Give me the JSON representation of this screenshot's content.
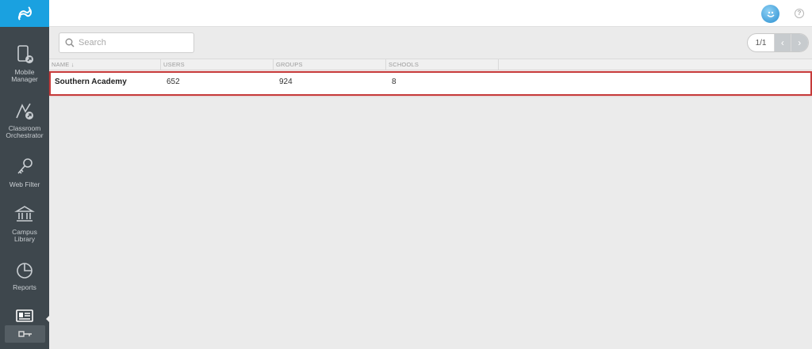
{
  "sidebar": {
    "items": [
      {
        "label_line1": "Mobile",
        "label_line2": "Manager",
        "icon": "mobile-manager-icon"
      },
      {
        "label_line1": "Classroom",
        "label_line2": "Orchestrator",
        "icon": "classroom-orchestrator-icon"
      },
      {
        "label_line1": "Web Filter",
        "label_line2": "",
        "icon": "key-icon"
      },
      {
        "label_line1": "Campus",
        "label_line2": "Library",
        "icon": "library-icon"
      },
      {
        "label_line1": "Reports",
        "label_line2": "",
        "icon": "pie-chart-icon"
      }
    ],
    "active_icon": "id-card-icon",
    "sub_icon": "key-small-icon"
  },
  "search": {
    "placeholder": "Search"
  },
  "pagination": {
    "label": "1/1",
    "prev": "‹",
    "next": "›"
  },
  "table": {
    "columns": [
      "NAME ↓",
      "USERS",
      "GROUPS",
      "SCHOOLS"
    ],
    "rows": [
      {
        "name": "Southern Academy",
        "users": "652",
        "groups": "924",
        "schools": "8"
      }
    ]
  },
  "colors": {
    "sidebar": "#3e474d",
    "brand": "#1aa1e0",
    "highlight": "#c63a3a"
  }
}
